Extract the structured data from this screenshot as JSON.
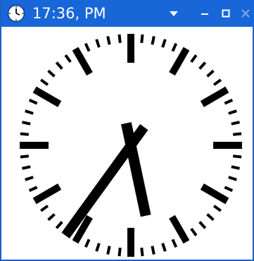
{
  "window": {
    "title": "17:36, PM",
    "controls": {
      "menu_icon": "dropdown-arrow",
      "minimize_icon": "minimize",
      "maximize_icon": "maximize",
      "close_icon": "close"
    }
  },
  "clock": {
    "time": {
      "hours": 17,
      "minutes": 36
    },
    "style": "station-clock",
    "face_color": "#ffffff",
    "mark_color": "#000000"
  },
  "colors": {
    "titlebar": "#1966d8",
    "title_text": "#ffffff",
    "close_disabled": "#7fa8e8"
  }
}
